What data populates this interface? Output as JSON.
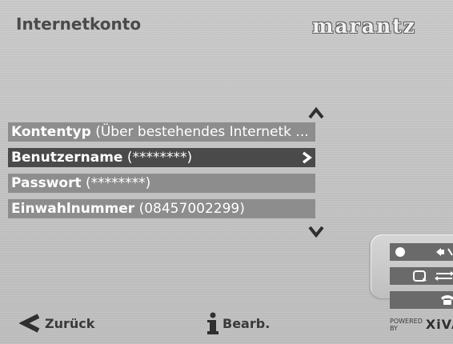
{
  "header": {
    "title": "Internetkonto",
    "brand": "marantz"
  },
  "list": {
    "items": [
      {
        "key": "Kontentyp",
        "value": " (Über bestehendes Internetk ...",
        "selected": false
      },
      {
        "key": "Benutzername",
        "value": " (********)",
        "selected": true
      },
      {
        "key": "Passwort",
        "value": " (********)",
        "selected": false
      },
      {
        "key": "Einwahlnummer",
        "value": " (08457002299)",
        "selected": false
      }
    ]
  },
  "footer": {
    "back_label": "Zurück",
    "edit_label": "Bearb.",
    "powered_by": "POWERED BY",
    "xiva_logo": "XiVA"
  },
  "icons": {
    "scroll_up": "chevron-up-icon",
    "scroll_down": "chevron-down-icon",
    "back": "arrow-left-icon",
    "info": "info-icon",
    "record": "record-icon",
    "mute": "speaker-icon",
    "repeat": "repeat-icon",
    "shuffle": "shuffle-icon",
    "phone": "phone-icon"
  },
  "colors": {
    "row_bg": "#8d8d8d",
    "row_selected_bg": "#4a4a4a",
    "text_light": "#ffffff",
    "title": "#4a4a4a"
  }
}
